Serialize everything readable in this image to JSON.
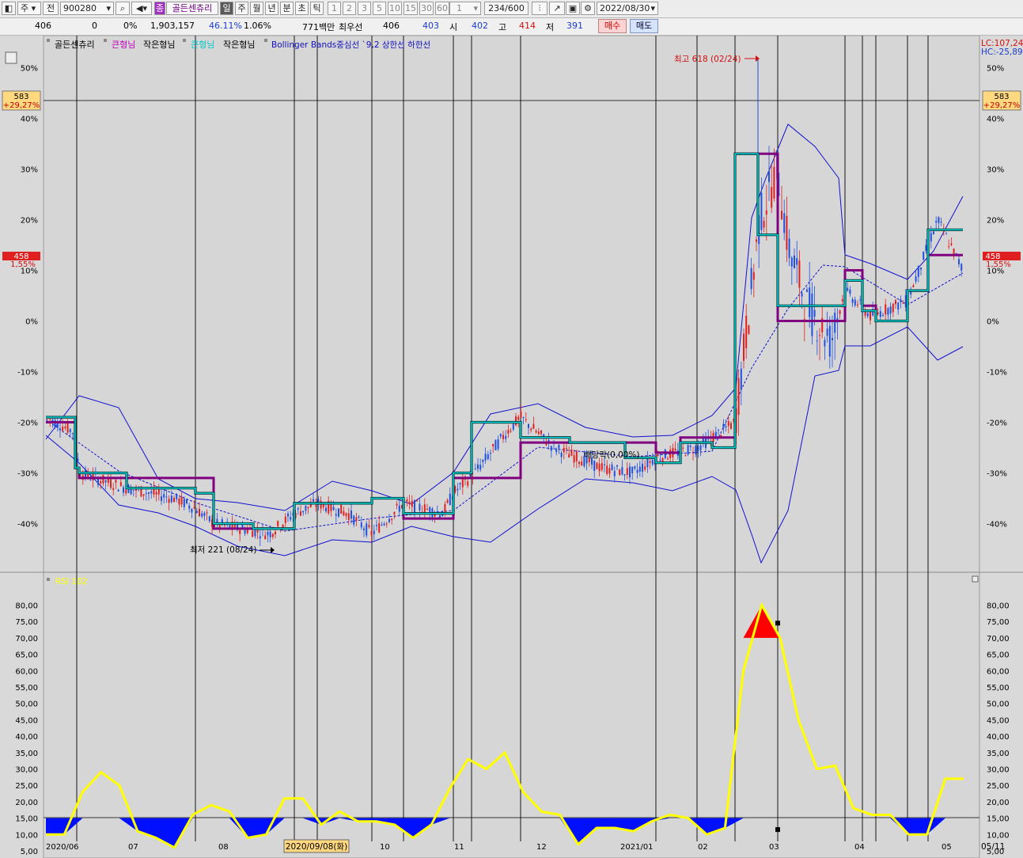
{
  "toolbar": {
    "market": "주",
    "prev": "전",
    "code": "900280",
    "badge": "종",
    "name": "골든센츄리",
    "periods": [
      "일",
      "주",
      "월",
      "년",
      "분",
      "초",
      "틱"
    ],
    "numbers": [
      "1",
      "2",
      "3",
      "5",
      "10",
      "15",
      "30",
      "60"
    ],
    "unit": "1",
    "count": "234",
    "count_total": "/600",
    "date": "2022/08/30"
  },
  "info": {
    "price": "406",
    "change": "0",
    "change_pct": "0%",
    "volume": "1,903,157",
    "rate1": "46.11%",
    "rate2": "1.06%",
    "amount": "771백만",
    "best_label": "최우선",
    "best_ask": "406",
    "best_bid": "403",
    "open_label": "시",
    "open": "402",
    "high_label": "고",
    "high": "414",
    "low_label": "저",
    "low": "391",
    "buy": "매수",
    "sell": "매도"
  },
  "chart": {
    "legend": {
      "name": "골든센츄리",
      "item1": "큰형님",
      "item2": "작은형님",
      "item3": "큰형님",
      "item4": "작은형님",
      "item5": "Bollinger Bands중심선 `9,2 상한선 하한선"
    },
    "lc": "LC:107,24",
    "hc": "HC:-25,89",
    "left_box_price": "583",
    "left_box_pct": "+29,27%",
    "right_box_price": "583",
    "right_box_pct": "+29,27%",
    "cur_price": "458",
    "cur_pct": "1,55%",
    "max_annot": "최고 618 (02/24)",
    "min_annot": "최저 221 (08/24)",
    "div_annot": "배당락(0,00%)",
    "lower_title": "RSI 102",
    "date_cursor": "2020/09/08(화)",
    "last_date": "05/11",
    "colors": {
      "grid_bg": "#d9d9d9",
      "accent_purple": "#800080",
      "accent_cyan": "#00c8c8",
      "band": "#1010d0",
      "rsi": "#ffff00"
    }
  },
  "chart_data": [
    {
      "type": "line",
      "title": "",
      "ylabel": "",
      "y_ticks": [
        "50%",
        "40%",
        "30%",
        "20%",
        "10%",
        "0%",
        "-10%",
        "-20%",
        "-30%",
        "-40%"
      ],
      "x_ticks": [
        "2020/06",
        "07",
        "08",
        "09",
        "10",
        "11",
        "12",
        "2021/01",
        "02",
        "03",
        "04",
        "05"
      ],
      "series": [
        {
          "name": "큰형님",
          "values": [
            -20,
            -29,
            -31,
            -31,
            -31,
            -41,
            -41,
            -36,
            -36,
            -35,
            -39,
            -31,
            -31,
            -24,
            -24,
            -24,
            -26,
            -23,
            -23,
            33,
            33,
            0,
            10,
            3,
            0,
            6,
            13
          ]
        },
        {
          "name": "작은형님",
          "values": [
            -19,
            -29,
            -30,
            -33,
            -34,
            -40,
            -41,
            -36,
            -36,
            -35,
            -38,
            -30,
            -20,
            -23,
            -24,
            -27,
            -28,
            -24,
            -25,
            33,
            17,
            3,
            8,
            2,
            0,
            6,
            18
          ]
        }
      ],
      "ylim": [
        -45,
        52
      ]
    },
    {
      "type": "line",
      "title": "RSI 102",
      "y_ticks": [
        "80,00",
        "75,00",
        "70,00",
        "65,00",
        "60,00",
        "55,00",
        "50,00",
        "45,00",
        "40,00",
        "35,00",
        "30,00",
        "25,00",
        "20,00",
        "15,00",
        "10,00",
        "5,00"
      ],
      "series": [
        {
          "name": "RSI 102",
          "values": [
            10,
            10,
            23,
            29,
            25,
            11,
            9,
            6,
            16,
            19,
            17,
            9,
            10,
            21,
            21,
            13,
            17,
            14,
            14,
            13,
            9,
            13,
            24,
            33,
            30,
            35,
            23,
            17,
            16,
            7,
            12,
            12,
            11,
            14,
            16,
            15,
            10,
            12,
            60,
            80,
            70,
            45,
            30,
            31,
            18,
            16,
            16,
            10,
            10,
            27,
            27
          ]
        }
      ],
      "ylim": [
        5,
        80
      ]
    }
  ]
}
